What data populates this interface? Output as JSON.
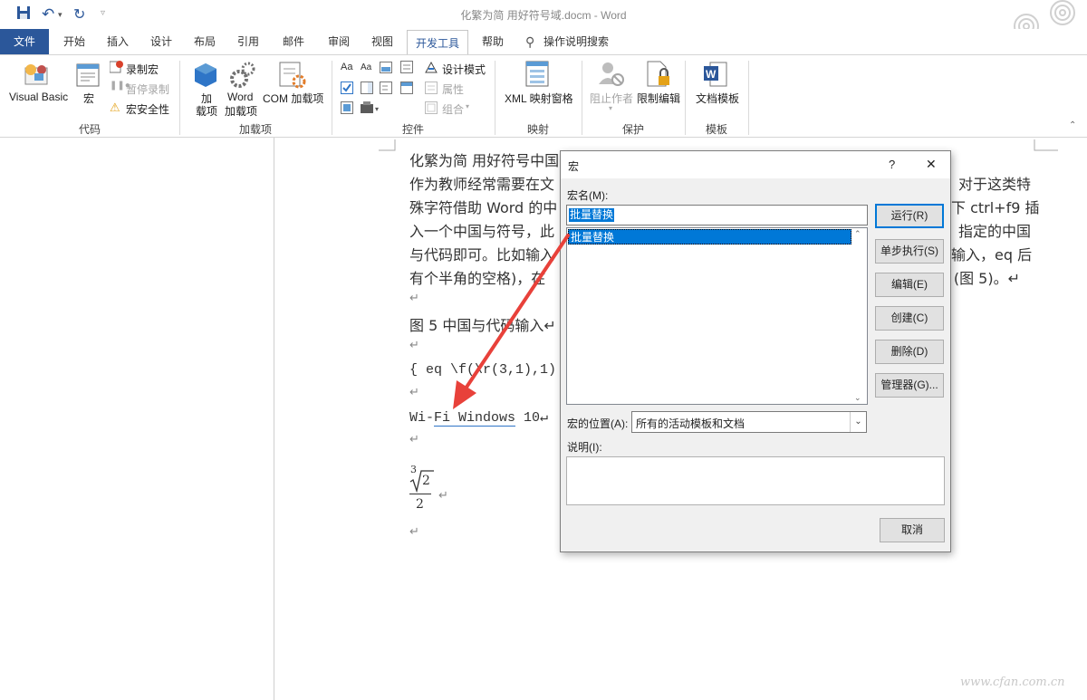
{
  "titlebar": {
    "title": "化繁为简 用好符号域.docm  -  Word"
  },
  "tabs": [
    {
      "label": "文件"
    },
    {
      "label": "开始"
    },
    {
      "label": "插入"
    },
    {
      "label": "设计"
    },
    {
      "label": "布局"
    },
    {
      "label": "引用"
    },
    {
      "label": "邮件"
    },
    {
      "label": "审阅"
    },
    {
      "label": "视图"
    },
    {
      "label": "开发工具"
    },
    {
      "label": "帮助"
    },
    {
      "label": "操作说明搜索"
    }
  ],
  "ribbon": {
    "code": {
      "visual_basic": "Visual Basic",
      "macros": "宏",
      "record_macro": "录制宏",
      "pause_recording": "暂停录制",
      "macro_security": "宏安全性",
      "group": "代码"
    },
    "addins": {
      "addins_line1": "加",
      "addins_line2": "载项",
      "word_addins_line1": "Word",
      "word_addins_line2": "加载项",
      "com_addins": "COM 加载项",
      "group": "加载项"
    },
    "controls": {
      "design_mode": "设计模式",
      "properties": "属性",
      "group_combo": "组合",
      "group": "控件"
    },
    "mapping": {
      "xml_pane": "XML 映射窗格",
      "group": "映射"
    },
    "protect": {
      "block_authors": "阻止作者",
      "restrict_editing": "限制编辑",
      "group": "保护"
    },
    "templates": {
      "document_template": "文档模板",
      "group": "模板"
    }
  },
  "document": {
    "line1": "化繁为简  用好符号中国",
    "line2_left": "作为教师经常需要在文",
    "line2_right": "对于这类特",
    "line3_left": "殊字符借助 Word 的中",
    "line3_right": "下 ctrl+f9 插",
    "line4_left": "入一个中国与符号，此",
    "line4_right": "指定的中国",
    "line5_left": "与代码即可。比如输入",
    "line5_right": "输入，eq 后",
    "line6_left": "有个半角的空格)，在",
    "line6_right": "(图 5)。↵",
    "figure_caption": "图 5  中国与代码输入↵",
    "field_code": "{ eq \\f(\\r(3,1),1)",
    "wifi_prefix": "Wi-",
    "wifi_link": "Fi  Windows",
    "wifi_suffix": " 10↵",
    "radical_index": "3",
    "radical_radicand": "2",
    "radical_denominator": "2",
    "para_mark": "↵"
  },
  "dialog": {
    "title": "宏",
    "help": "?",
    "close": "✕",
    "macro_name_label": "宏名(M):",
    "macro_name_value": "批量替换",
    "macro_list": [
      "批量替换"
    ],
    "buttons": {
      "run": "运行(R)",
      "step_into": "单步执行(S)",
      "edit": "编辑(E)",
      "create": "创建(C)",
      "delete": "删除(D)",
      "organizer": "管理器(G)...",
      "cancel": "取消"
    },
    "macros_in_label": "宏的位置(A):",
    "macros_in_value": "所有的活动模板和文档",
    "description_label": "说明(I):"
  },
  "watermark": "www.cfan.com.cn",
  "colors": {
    "accent": "#2b579a",
    "selection": "#0078d7",
    "arrow": "#e8413a"
  }
}
